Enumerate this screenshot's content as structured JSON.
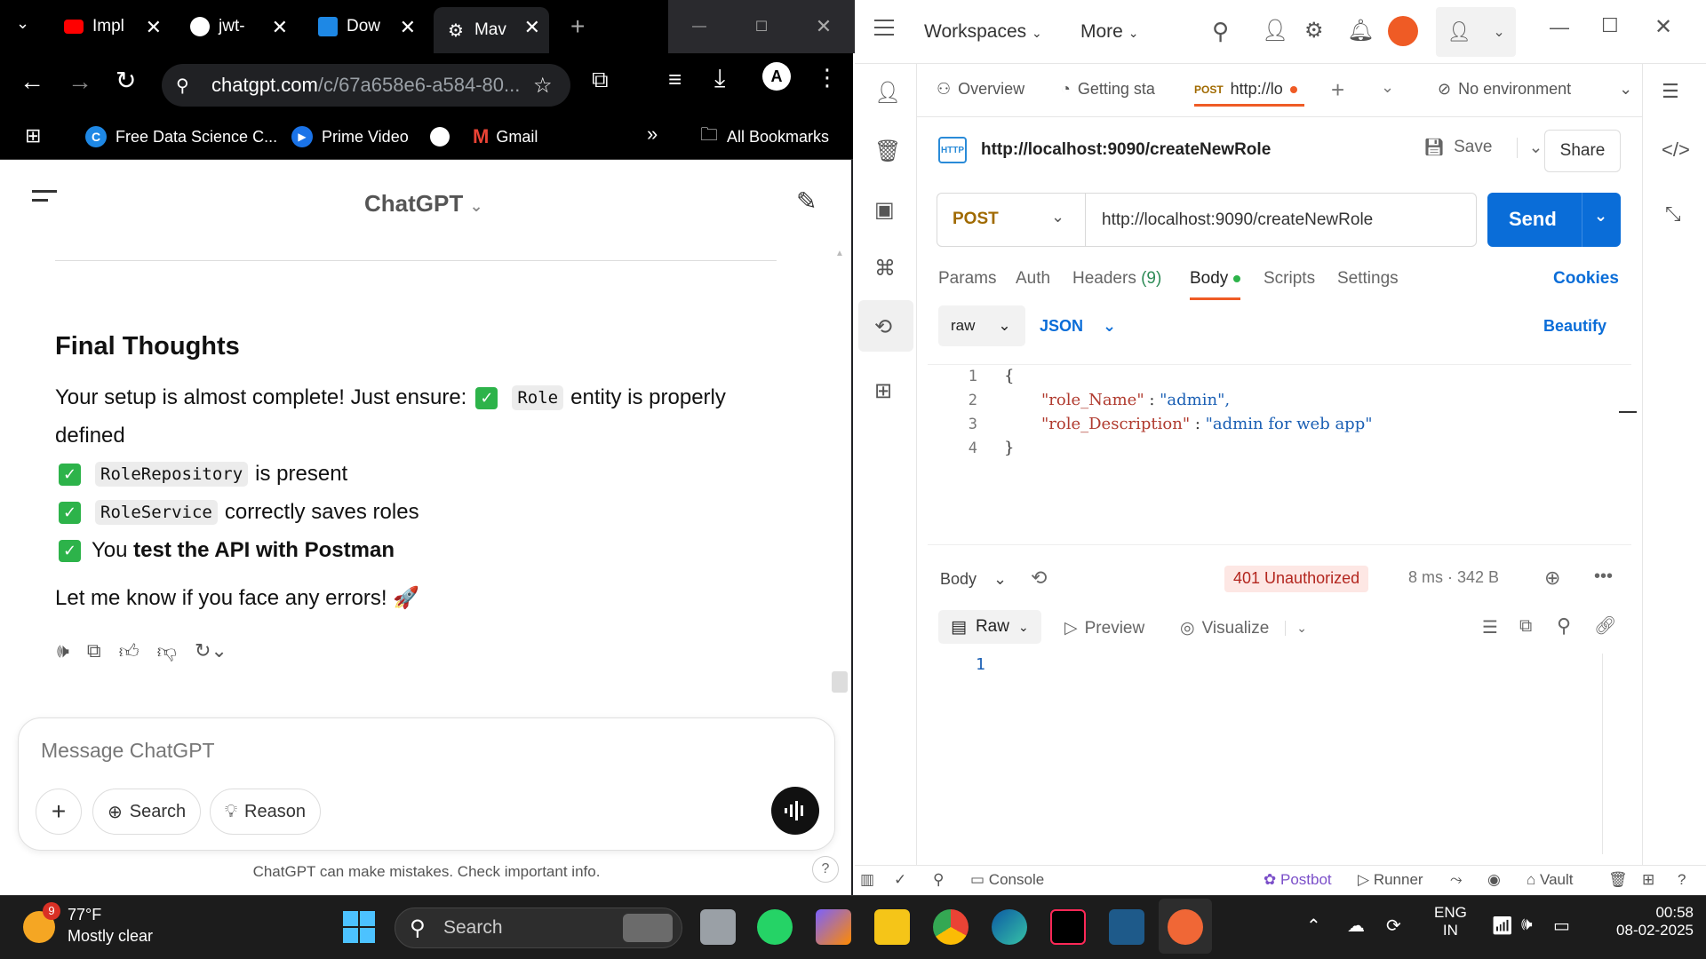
{
  "chrome": {
    "tabs": [
      "Impl",
      "jwt-",
      "Dow",
      "Mav"
    ],
    "url_host": "chatgpt.com",
    "url_path": "/c/67a658e6-a584-80...",
    "bookmarks": [
      "Free Data Science C...",
      "Prime Video",
      "Gmail"
    ],
    "all_bookmarks": "All Bookmarks"
  },
  "chatgpt": {
    "title": "ChatGPT",
    "heading": "Final Thoughts",
    "intro_a": "Your setup is almost complete! Just ensure:",
    "intro_code": "Role",
    "intro_b": "entity is properly",
    "intro_c": "defined",
    "items": [
      {
        "code": "RoleRepository",
        "text": "is present"
      },
      {
        "code": "RoleService",
        "text": "correctly saves roles"
      }
    ],
    "last_item_pre": "You",
    "last_item_bold": "test the API with Postman",
    "closing": "Let me know if you face any errors! 🚀",
    "message_placeholder": "Message ChatGPT",
    "search_label": "Search",
    "reason_label": "Reason",
    "disclaimer": "ChatGPT can make mistakes. Check important info.",
    "help": "?"
  },
  "postman": {
    "workspaces": "Workspaces",
    "more": "More",
    "tabs": {
      "overview": "Overview",
      "getting_started": "Getting sta",
      "post_method": "POST",
      "post_url": "http://lo"
    },
    "environment": "No environment",
    "request_name": "http://localhost:9090/createNewRole",
    "save": "Save",
    "share": "Share",
    "method": "POST",
    "url": "http://localhost:9090/createNewRole",
    "send": "Send",
    "req_tabs": [
      "Params",
      "Auth",
      "Headers",
      "(9)",
      "Body",
      "Scripts",
      "Settings"
    ],
    "cookies": "Cookies",
    "body_mode": "raw",
    "body_lang": "JSON",
    "beautify": "Beautify",
    "code_lines": [
      {
        "n": "1",
        "text": "{"
      },
      {
        "n": "2",
        "key": "\"role_Name\"",
        "sep": " : ",
        "val": "\"admin\","
      },
      {
        "n": "3",
        "key": "\"role_Description\"",
        "sep": " : ",
        "val": "\"admin for web app\""
      },
      {
        "n": "4",
        "text": "}"
      }
    ],
    "response": {
      "body_label": "Body",
      "status": "401 Unauthorized",
      "time": "8 ms",
      "size": "342 B",
      "view_raw": "Raw",
      "preview": "Preview",
      "visualize": "Visualize",
      "line": "1"
    },
    "statusbar": {
      "console": "Console",
      "postbot": "Postbot",
      "runner": "Runner",
      "vault": "Vault"
    }
  },
  "taskbar": {
    "temp": "77°F",
    "weather": "Mostly clear",
    "weather_badge": "9",
    "search": "Search",
    "lang1": "ENG",
    "lang2": "IN",
    "time": "00:58",
    "date": "08-02-2025"
  }
}
